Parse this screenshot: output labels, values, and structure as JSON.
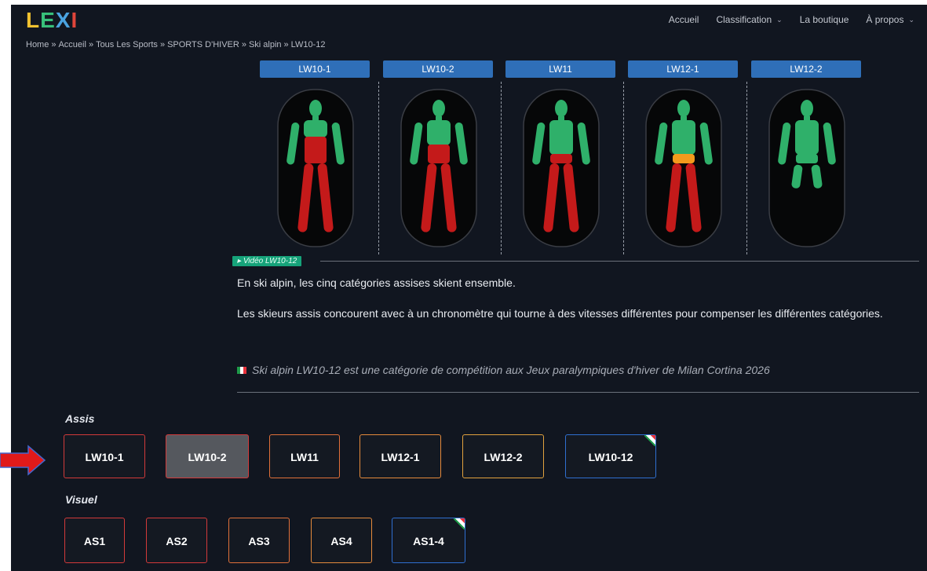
{
  "header": {
    "logo": "LEXI",
    "nav": [
      {
        "label": "Accueil",
        "has_dropdown": false
      },
      {
        "label": "Classification",
        "has_dropdown": true
      },
      {
        "label": "La boutique",
        "has_dropdown": false
      },
      {
        "label": "À propos",
        "has_dropdown": true
      }
    ]
  },
  "breadcrumb": [
    "Home",
    "Accueil",
    "Tous Les Sports",
    "SPORTS D'HIVER",
    "Ski alpin",
    "LW10-12"
  ],
  "breadcrumb_sep": "»",
  "categories": [
    {
      "label": "LW10-1"
    },
    {
      "label": "LW10-2"
    },
    {
      "label": "LW11"
    },
    {
      "label": "LW12-1"
    },
    {
      "label": "LW12-2"
    }
  ],
  "video_label": "Vidéo LW10-12",
  "description": [
    "En ski alpin, les cinq catégories assises skient ensemble.",
    "Les skieurs assis concourent avec à un chronomètre qui tourne à des vitesses différentes pour compenser les différentes catégories."
  ],
  "paralympic_note": "Ski alpin LW10-12 est une catégorie de compétition aux Jeux paralympiques d'hiver de Milan Cortina 2026",
  "sections": [
    {
      "title": "Assis",
      "buttons": [
        {
          "label": "LW10-1",
          "color": "#d23a3a"
        },
        {
          "label": "LW10-2",
          "color": "#d23a3a",
          "active": true
        },
        {
          "label": "LW11",
          "color": "#e0703a"
        },
        {
          "label": "LW12-1",
          "color": "#e58a3c"
        },
        {
          "label": "LW12-2",
          "color": "#e2a23e"
        },
        {
          "label": "LW10-12",
          "color": "#2f6fd0",
          "flag": true
        }
      ]
    },
    {
      "title": "Visuel",
      "buttons": [
        {
          "label": "AS1",
          "color": "#d23a3a"
        },
        {
          "label": "AS2",
          "color": "#d23a3a"
        },
        {
          "label": "AS3",
          "color": "#e0703a"
        },
        {
          "label": "AS4",
          "color": "#e58a3c"
        },
        {
          "label": "AS1-4",
          "color": "#2f6fd0",
          "flag": true
        }
      ]
    }
  ],
  "colors": {
    "background": "#111620",
    "tab": "#2f6fb8",
    "green": "#2fb06a",
    "red": "#c41a1a",
    "orange": "#f39a1c",
    "video_badge": "#16a37a"
  }
}
